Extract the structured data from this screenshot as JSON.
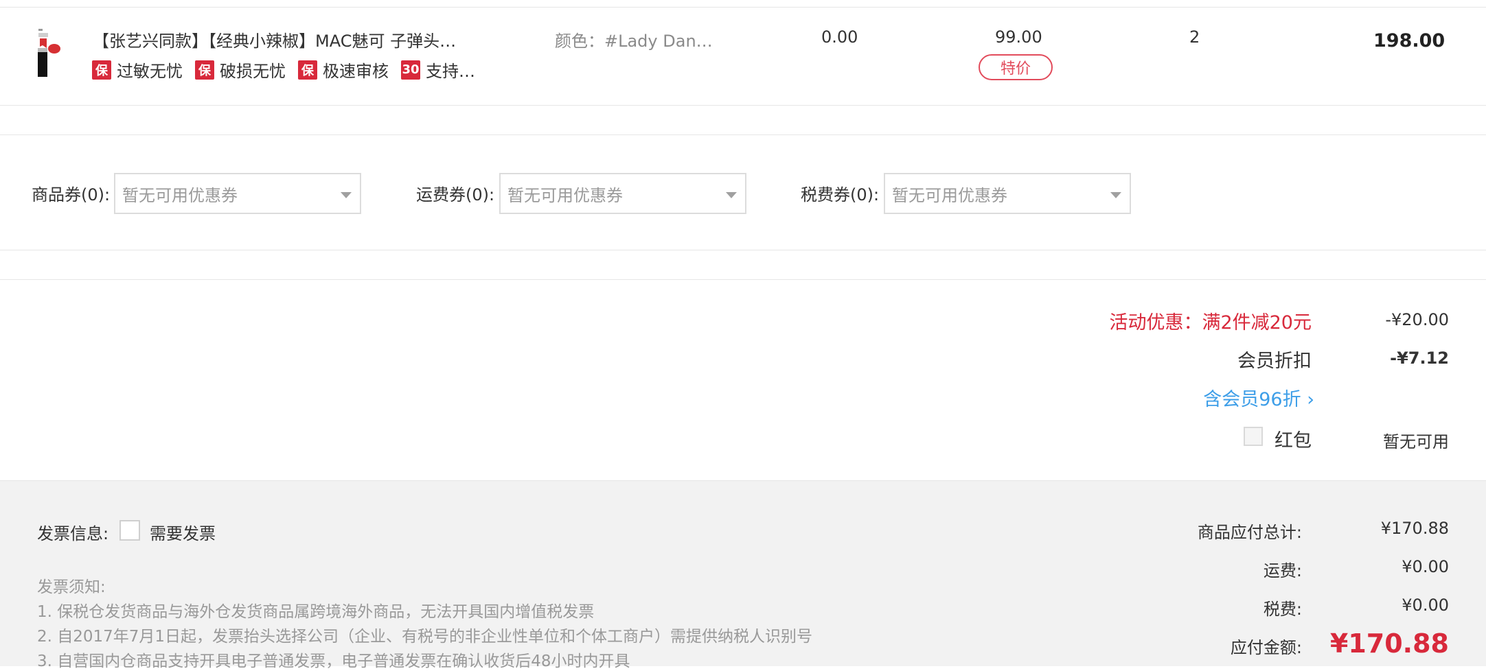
{
  "product": {
    "title": "【张艺兴同款】【经典小辣椒】MAC魅可 子弹头…",
    "tags": [
      {
        "badge": "保",
        "label": "过敏无忧"
      },
      {
        "badge": "保",
        "label": "破损无忧"
      },
      {
        "badge": "保",
        "label": "极速审核"
      },
      {
        "badge": "30",
        "label": "支持…"
      }
    ],
    "attribute": "颜色：#Lady Dan…",
    "tax": "0.00",
    "price": "99.00",
    "special_tag": "特价",
    "quantity": "2",
    "subtotal": "198.00"
  },
  "coupons": [
    {
      "label": "商品券(0):",
      "value": "暂无可用优惠券"
    },
    {
      "label": "运费券(0):",
      "value": "暂无可用优惠券"
    },
    {
      "label": "税费券(0):",
      "value": "暂无可用优惠券"
    }
  ],
  "discounts": {
    "activity_label": "活动优惠：满2件减20元",
    "activity_value": "-¥20.00",
    "member_label": "会员折扣",
    "member_value": "-¥7.12",
    "member_link": "含会员96折 ›",
    "redpacket_label": "红包",
    "redpacket_value": "暂无可用"
  },
  "invoice": {
    "label": "发票信息:",
    "need_label": "需要发票",
    "notice_title": "发票须知:",
    "notices": [
      "1. 保税仓发货商品与海外仓发货商品属跨境海外商品，无法开具国内增值税发票",
      "2. 自2017年7月1日起，发票抬头选择公司（企业、有税号的非企业性单位和个体工商户）需提供纳税人识别号",
      "3. 自营国内仓商品支持开具电子普通发票，电子普通发票在确认收货后48小时内开具"
    ]
  },
  "summary": {
    "goods_total_label": "商品应付总计:",
    "goods_total_value": "¥170.88",
    "shipping_label": "运费:",
    "shipping_value": "¥0.00",
    "tax_label": "税费:",
    "tax_value": "¥0.00",
    "payable_label": "应付金额:",
    "payable_value": "¥170.88"
  },
  "colors": {
    "accent_red": "#d8293b",
    "link_blue": "#3d9ee8"
  }
}
